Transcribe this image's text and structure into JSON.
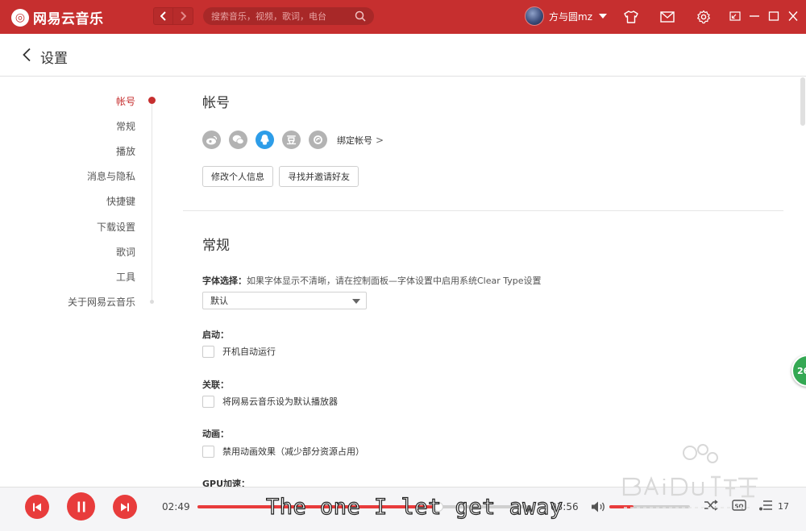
{
  "app": {
    "logo_text": "网易云音乐",
    "logo_glyph": "◎",
    "accent_color": "#c62f2f"
  },
  "topbar": {
    "search_placeholder": "搜索音乐，视频，歌词，电台",
    "username": "方与圆mz",
    "icons": [
      "back-arrow-icon",
      "forward-arrow-icon",
      "search-icon",
      "skin-icon",
      "mail-icon",
      "gear-icon",
      "mini-mode-icon",
      "minimize-icon",
      "maximize-icon",
      "close-icon"
    ]
  },
  "header": {
    "title": "设置"
  },
  "sidebar": {
    "items": [
      {
        "label": "帐号",
        "active": true
      },
      {
        "label": "常规",
        "active": false
      },
      {
        "label": "播放",
        "active": false
      },
      {
        "label": "消息与隐私",
        "active": false
      },
      {
        "label": "快捷键",
        "active": false
      },
      {
        "label": "下载设置",
        "active": false
      },
      {
        "label": "歌词",
        "active": false
      },
      {
        "label": "工具",
        "active": false
      },
      {
        "label": "关于网易云音乐",
        "active": false
      }
    ]
  },
  "account": {
    "title": "帐号",
    "social_icons": [
      "weibo-icon",
      "wechat-icon",
      "qq-icon",
      "douban-icon",
      "yixin-icon"
    ],
    "douban_glyph": "豆",
    "bind_label": "绑定帐号",
    "bind_arrow": ">",
    "edit_profile": "修改个人信息",
    "find_friends": "寻找并邀请好友"
  },
  "general": {
    "title": "常规",
    "font_label": "字体选择：",
    "font_hint": "如果字体显示不清晰，请在控制面板—字体设置中启用系统Clear Type设置",
    "font_value": "默认",
    "startup_label": "启动：",
    "startup_option": "开机自动运行",
    "assoc_label": "关联：",
    "assoc_option": "将网易云音乐设为默认播放器",
    "anim_label": "动画：",
    "anim_option": "禁用动画效果（减少部分资源占用）",
    "gpu_label": "GPU加速："
  },
  "player": {
    "current_time": "02:49",
    "total_time": "03:56",
    "progress": 0.73,
    "volume": 0.3,
    "quality_label": "SQ",
    "playlist_count": "17",
    "lyric": "The one I let get away"
  },
  "overlay": {
    "badge_text": "26"
  }
}
